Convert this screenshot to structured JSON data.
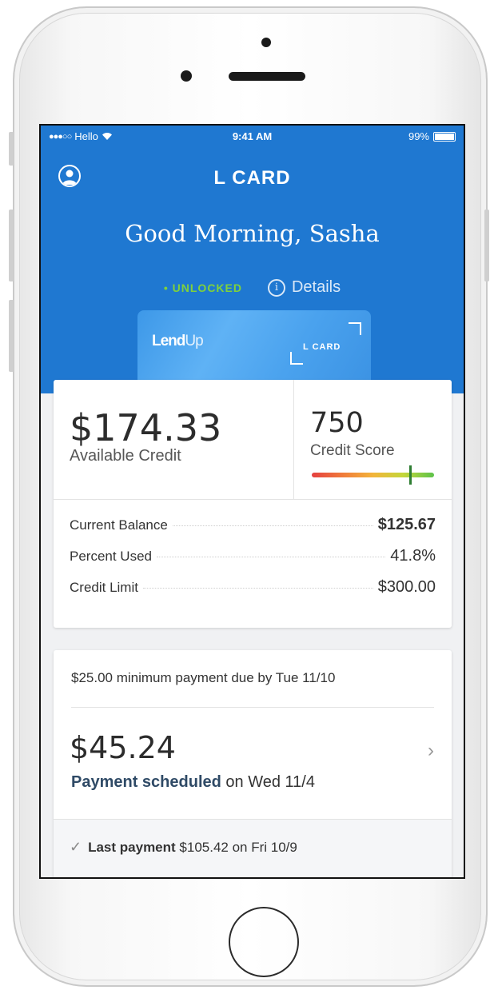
{
  "status_bar": {
    "carrier": "Hello",
    "time": "9:41 AM",
    "battery": "99%"
  },
  "header": {
    "title": "L CARD",
    "greeting": "Good Morning, Sasha"
  },
  "card_status": {
    "state": "• UNLOCKED",
    "details_label": "Details"
  },
  "card": {
    "logo_main": "Lend",
    "logo_suffix": "Up",
    "brand": "L CARD"
  },
  "summary": {
    "available_amount": "$174.33",
    "available_label": "Available Credit",
    "credit_score": "750",
    "credit_score_label": "Credit Score",
    "rows": [
      {
        "label": "Current Balance",
        "value": "$125.67"
      },
      {
        "label": "Percent Used",
        "value": "41.8%"
      },
      {
        "label": "Credit Limit",
        "value": "$300.00"
      }
    ]
  },
  "payment": {
    "due_text": "$25.00 minimum payment due by Tue 11/10",
    "scheduled_amount": "$45.24",
    "scheduled_bold": "Payment scheduled",
    "scheduled_rest": " on Wed 11/4",
    "last_bold": "Last payment",
    "last_rest": " $105.42 on Fri 10/9"
  },
  "colors": {
    "header_blue": "#1f78d1",
    "unlocked_green": "#7fd13b"
  },
  "icons": {
    "profile": "user-circle-icon",
    "info": "info-circle-icon",
    "chevron": "chevron-right-icon",
    "check": "check-icon"
  }
}
